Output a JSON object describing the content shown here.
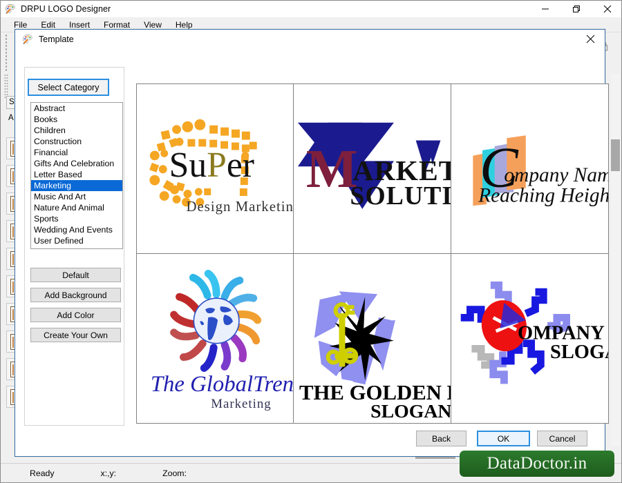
{
  "window": {
    "title": "DRPU LOGO Designer",
    "app_icon": "palette-icon",
    "minimize": "minimize-icon",
    "restore": "restore-icon",
    "close": "close-icon"
  },
  "menu": {
    "items": [
      {
        "label": "File"
      },
      {
        "label": "Edit"
      },
      {
        "label": "Insert"
      },
      {
        "label": "Format"
      },
      {
        "label": "View"
      },
      {
        "label": "Help"
      }
    ]
  },
  "background": {
    "symbol_tab": "Sy",
    "align_label": "A",
    "lock_icon": "lock-icon"
  },
  "dialog": {
    "title": "Template",
    "icon": "palette-icon",
    "close": "close-icon",
    "category_tab": "Select Category",
    "categories": [
      {
        "label": "Abstract",
        "selected": false
      },
      {
        "label": "Books",
        "selected": false
      },
      {
        "label": "Children",
        "selected": false
      },
      {
        "label": "Construction",
        "selected": false
      },
      {
        "label": "Financial",
        "selected": false
      },
      {
        "label": "Gifts And Celebration",
        "selected": false
      },
      {
        "label": "Letter Based",
        "selected": false
      },
      {
        "label": "Marketing",
        "selected": true
      },
      {
        "label": "Music And Art",
        "selected": false
      },
      {
        "label": "Nature And Animal",
        "selected": false
      },
      {
        "label": "Sports",
        "selected": false
      },
      {
        "label": "Wedding And Events",
        "selected": false
      },
      {
        "label": "User Defined",
        "selected": false
      }
    ],
    "side_buttons": [
      {
        "label": "Default"
      },
      {
        "label": "Add Background"
      },
      {
        "label": "Add Color"
      },
      {
        "label": "Create Your Own"
      }
    ],
    "templates": [
      {
        "id": "super-design-marketing",
        "name": "SuPer",
        "tagline": "Design Marketing",
        "colors": {
          "dots": "#F5A623",
          "name_dark": "#1a1a1a",
          "name_accent": "#8a7a1e",
          "tagline": "#333333"
        }
      },
      {
        "id": "market-solution",
        "name": "M",
        "name_rest": "ARKET",
        "tagline": "SOLUTION",
        "colors": {
          "triangle": "#1b1b8f",
          "letter": "#7d1f3d",
          "text": "#111111"
        }
      },
      {
        "id": "company-name-reaching-heighest",
        "name": "Company Name",
        "tagline": "Reaching Heighest",
        "colors": {
          "bar_orange": "#F5A05A",
          "bar_cyan": "#2ED0E0",
          "bar_purple": "#A8A8DC",
          "text": "#0d0d0d"
        }
      },
      {
        "id": "the-globaltrend-marketing",
        "name": "The GlobalTrend",
        "tagline": "Marketing",
        "colors": {
          "globe": "#2B4FC8",
          "text": "#2020B0",
          "tagline": "#333355"
        }
      },
      {
        "id": "the-golden-key",
        "name": "THE GOLDEN KEY",
        "tagline": "SLOGAN",
        "colors": {
          "shard": "#9090F0",
          "star": "#000000",
          "key": "#CFCF00",
          "text": "#000000"
        }
      },
      {
        "id": "company-name-slogan",
        "name": "COMPANY NAME",
        "name_visible": "OMPANY NAME",
        "tagline": "SLOGAN",
        "colors": {
          "circle": "#EE1111",
          "zig_dark": "#1818E0",
          "zig_light": "#8C8CEE",
          "zig_gray": "#B8B8B8",
          "text": "#000000"
        }
      }
    ],
    "footer_buttons": [
      {
        "label": "Back",
        "focused": false
      },
      {
        "label": "OK",
        "focused": true
      },
      {
        "label": "Cancel",
        "focused": false
      }
    ]
  },
  "statusbar": {
    "ready": "Ready",
    "coords": "x:,y:",
    "zoom": "Zoom:"
  },
  "watermark": {
    "text": "DataDoctor.in",
    "color": "#1d5c1d"
  }
}
